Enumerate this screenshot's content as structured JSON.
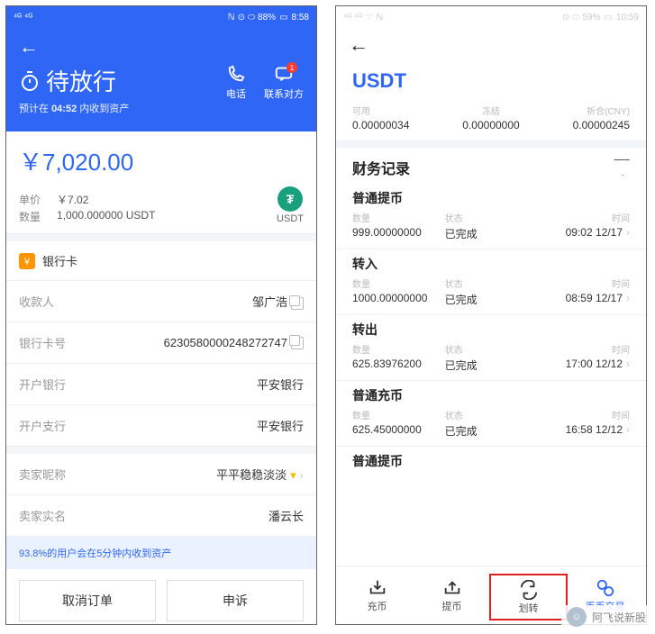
{
  "left": {
    "status": {
      "left": "⁴ᴳ ⁴ᴳ",
      "right_icons": "ℕ ⊙ ⬭ 88%",
      "battery": "88%",
      "time": "8:58"
    },
    "header": {
      "back": "←",
      "title": "待放行",
      "sub_pre": "预计在 ",
      "sub_time": "04:52",
      "sub_post": " 内收到资产",
      "phone_label": "电话",
      "contact_label": "联系对方",
      "badge": "1"
    },
    "amount": "￥7,020.00",
    "meta": {
      "unit_label": "单价",
      "unit_value": "￥7.02",
      "qty_label": "数量",
      "qty_value": "1,000.000000 USDT",
      "coin_symbol": "₮",
      "coin_name": "USDT"
    },
    "bankcard_label": "银行卡",
    "rows": {
      "payee_label": "收款人",
      "payee_value": "邹广浩",
      "cardno_label": "银行卡号",
      "cardno_value": "6230580000248272747",
      "bank_label": "开户银行",
      "bank_value": "平安银行",
      "branch_label": "开户支行",
      "branch_value": "平安银行",
      "seller_nick_label": "卖家昵称",
      "seller_nick_value": "平平稳稳淡淡",
      "seller_name_label": "卖家实名",
      "seller_name_value": "潘云长"
    },
    "tip": "93.8%的用户会在5分钟内收到资产",
    "actions": {
      "cancel": "取消订单",
      "appeal": "申诉"
    }
  },
  "right": {
    "status": {
      "left": "⁴ᴳ ⁴ᴳ ⌔ ℕ",
      "right": "⊙ ⬭ 59%",
      "battery": "59%",
      "time": "10:59"
    },
    "back": "←",
    "title": "USDT",
    "balances": {
      "avail_label": "可用",
      "avail_value": "0.00000034",
      "frozen_label": "冻结",
      "frozen_value": "0.00000000",
      "cny_label": "折合(CNY)",
      "cny_value": "0.00000245"
    },
    "records_title": "财务记录",
    "col": {
      "qty": "数量",
      "status": "状态",
      "time": "时间"
    },
    "records": [
      {
        "type": "普通提币",
        "qty": "999.00000000",
        "status": "已完成",
        "time": "09:02 12/17"
      },
      {
        "type": "转入",
        "qty": "1000.00000000",
        "status": "已完成",
        "time": "08:59 12/17"
      },
      {
        "type": "转出",
        "qty": "625.83976200",
        "status": "已完成",
        "time": "17:00 12/12"
      },
      {
        "type": "普通充币",
        "qty": "625.45000000",
        "status": "已完成",
        "time": "16:58 12/12"
      },
      {
        "type": "普通提币",
        "qty": "",
        "status": "",
        "time": ""
      }
    ],
    "tabs": {
      "deposit": "充币",
      "withdraw": "提币",
      "transfer": "划转",
      "exchange": "币币交易"
    }
  },
  "watermark": "阿飞说新股"
}
